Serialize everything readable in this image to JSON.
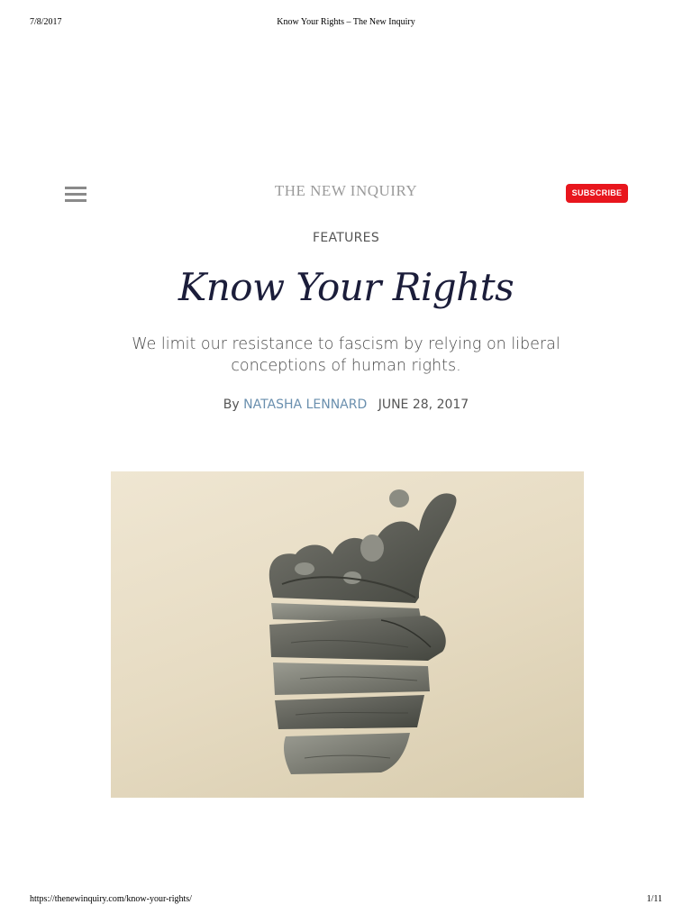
{
  "print_header": {
    "date": "7/8/2017",
    "title": "Know Your Rights – The New Inquiry"
  },
  "print_footer": {
    "url": "https://thenewinquiry.com/know-your-rights/",
    "page": "1/11"
  },
  "header": {
    "menu_icon": "hamburger-menu-icon",
    "logo": "THE NEW INQUIRY",
    "subscribe_label": "SUBSCRIBE"
  },
  "article": {
    "section": "FEATURES",
    "title": "Know Your Rights",
    "dek": "We limit our resistance to fascism by relying on liberal conceptions of human rights.",
    "byline_prefix": "By",
    "author": "NATASHA LENNARD",
    "date": "JUNE 28, 2017"
  },
  "hero_image": {
    "subject": "sliced-fist-illustration"
  },
  "colors": {
    "accent_red": "#e8161d",
    "title_navy": "#1b1d3a",
    "author_link": "#6a8fae",
    "image_background": "#e6dbc2"
  }
}
